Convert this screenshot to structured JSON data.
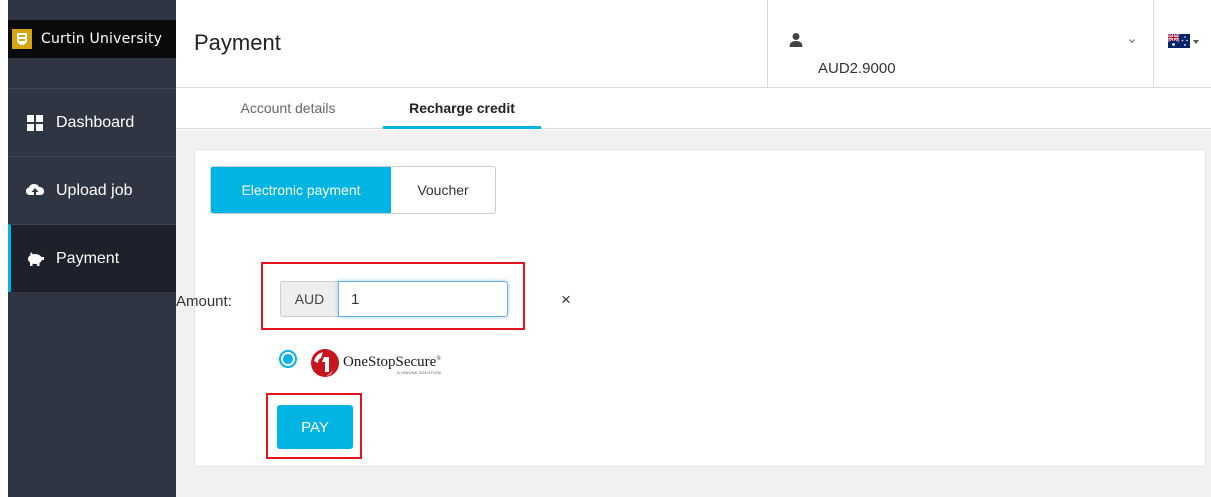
{
  "brand": {
    "name": "Curtin University"
  },
  "sidebar": {
    "items": [
      {
        "label": "Dashboard",
        "icon": "grid-icon",
        "active": false
      },
      {
        "label": "Upload job",
        "icon": "cloud-upload-icon",
        "active": false
      },
      {
        "label": "Payment",
        "icon": "piggy-bank-icon",
        "active": true
      }
    ]
  },
  "header": {
    "title": "Payment",
    "balance": "AUD2.9000",
    "user_icon": "user-icon",
    "flag_icon": "australia-flag-icon"
  },
  "tabs": [
    {
      "label": "Account details",
      "active": false
    },
    {
      "label": "Recharge credit",
      "active": true
    }
  ],
  "payment": {
    "methods": [
      {
        "label": "Electronic payment",
        "active": true
      },
      {
        "label": "Voucher",
        "active": false
      }
    ],
    "amount_label": "Amount:",
    "currency": "AUD",
    "amount_value": "1",
    "clear_glyph": "×",
    "provider_name": "OneStopSecure",
    "provider_tagline": "A UNIUNK SOLUTION",
    "provider_trademark": "®",
    "provider_selected": true,
    "pay_label": "PAY"
  },
  "colors": {
    "accent": "#00b4e4",
    "sidebar_bg": "#2f3542",
    "highlight_red": "#e8141c"
  }
}
